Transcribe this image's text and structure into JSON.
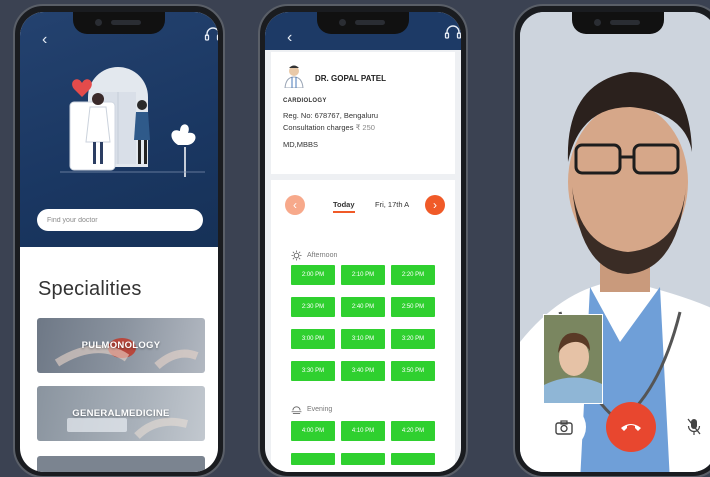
{
  "phone1": {
    "search_placeholder": "Find your doctor",
    "specialities_title": "Specialities",
    "specialities": [
      "PULMONOLOGY",
      "GENERALMEDICINE"
    ]
  },
  "phone2": {
    "doctor": {
      "name": "DR. GOPAL PATEL",
      "speciality": "CARDIOLOGY",
      "registration": "Reg. No: 678767, Bengaluru",
      "fee_label": "Consultation charges",
      "fee_amount": "₹ 250",
      "degrees": "MD,MBBS"
    },
    "date_tabs": [
      "Today",
      "Fri, 17th A"
    ],
    "afternoon_label": "Afternoon",
    "afternoon_slots": [
      "2:00 PM",
      "2:10 PM",
      "2:20 PM",
      "2:30 PM",
      "2:40 PM",
      "2:50 PM",
      "3:00 PM",
      "3:10 PM",
      "3:20 PM",
      "3:30 PM",
      "3:40 PM",
      "3:50 PM"
    ],
    "evening_label": "Evening",
    "evening_slots": [
      "4:00 PM",
      "4:10 PM",
      "4:20 PM"
    ]
  },
  "colors": {
    "accent": "#f05a28",
    "slot_green": "#2fd02f",
    "header_navy": "#1d3a66",
    "end_call": "#e8472f"
  },
  "icons": [
    "back-arrow-icon",
    "headset-icon",
    "sun-icon",
    "evening-icon",
    "camera-icon",
    "end-call-icon",
    "mic-off-icon"
  ]
}
